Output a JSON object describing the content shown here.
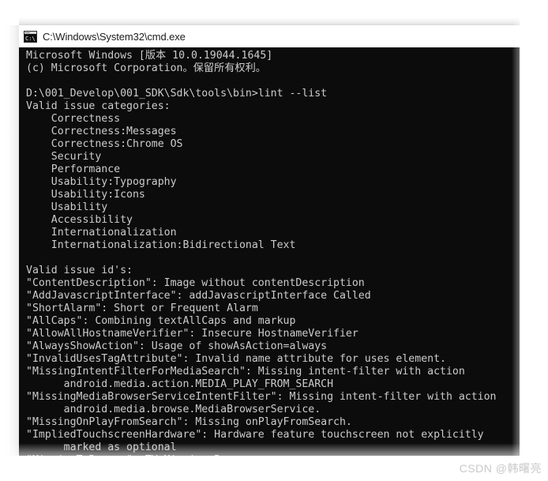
{
  "window": {
    "title": "C:\\Windows\\System32\\cmd.exe",
    "icon": "cmd-console-icon",
    "titlebar_bg": "#ffffff",
    "titlebar_fg": "#1b1b1b",
    "terminal_bg": "#0c0c0c",
    "terminal_fg": "#cccccc"
  },
  "terminal": {
    "lines": [
      "Microsoft Windows [版本 10.0.19044.1645]",
      "(c) Microsoft Corporation。保留所有权利。",
      "",
      "D:\\001_Develop\\001_SDK\\Sdk\\tools\\bin>lint --list",
      "Valid issue categories:",
      "    Correctness",
      "    Correctness:Messages",
      "    Correctness:Chrome OS",
      "    Security",
      "    Performance",
      "    Usability:Typography",
      "    Usability:Icons",
      "    Usability",
      "    Accessibility",
      "    Internationalization",
      "    Internationalization:Bidirectional Text",
      "",
      "Valid issue id's:",
      "\"ContentDescription\": Image without contentDescription",
      "\"AddJavascriptInterface\": addJavascriptInterface Called",
      "\"ShortAlarm\": Short or Frequent Alarm",
      "\"AllCaps\": Combining textAllCaps and markup",
      "\"AllowAllHostnameVerifier\": Insecure HostnameVerifier",
      "\"AlwaysShowAction\": Usage of showAsAction=always",
      "\"InvalidUsesTagAttribute\": Invalid name attribute for uses element.",
      "\"MissingIntentFilterForMediaSearch\": Missing intent-filter with action",
      "      android.media.action.MEDIA_PLAY_FROM_SEARCH",
      "\"MissingMediaBrowserServiceIntentFilter\": Missing intent-filter with action",
      "      android.media.browse.MediaBrowserService.",
      "\"MissingOnPlayFromSearch\": Missing onPlayFromSearch.",
      "\"ImpliedTouchscreenHardware\": Hardware feature touchscreen not explicitly",
      "      marked as optional",
      "\"MissingTvBanner\": TV Missing Banner"
    ],
    "command": "lint --list",
    "prompt_path": "D:\\001_Develop\\001_SDK\\Sdk\\tools\\bin>"
  },
  "watermark": {
    "text": "CSDN @韩曙亮",
    "color": "#c9c9c9"
  }
}
